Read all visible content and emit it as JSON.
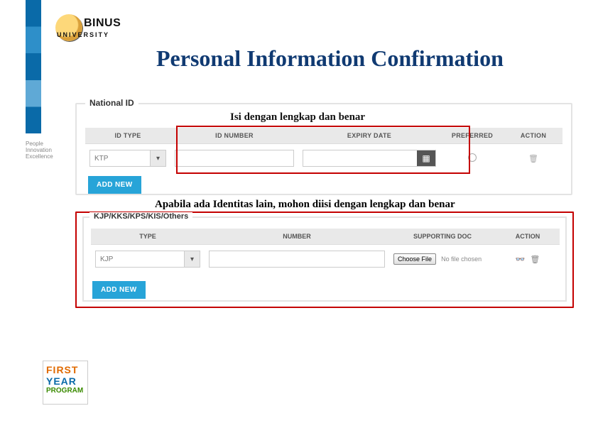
{
  "logo": {
    "brand": "BINUS",
    "sub": "UNIVERSITY"
  },
  "title": "Personal Information Confirmation",
  "side_tag": "People Innovation Excellence",
  "section1": {
    "legend": "National ID",
    "note": "Isi dengan lengkap dan benar",
    "headers": {
      "type": "ID TYPE",
      "number": "ID NUMBER",
      "expiry": "EXPIRY DATE",
      "preferred": "PREFERRED",
      "action": "ACTION"
    },
    "row": {
      "type_value": "KTP",
      "number_value": "",
      "expiry_value": ""
    },
    "add_label": "ADD NEW"
  },
  "section2": {
    "legend": "KJP/KKS/KPS/KIS/Others",
    "note": "Apabila ada Identitas lain, mohon diisi dengan lengkap dan benar",
    "headers": {
      "type": "TYPE",
      "number": "NUMBER",
      "doc": "SUPPORTING DOC",
      "action": "ACTION"
    },
    "row": {
      "type_value": "KJP",
      "number_value": "",
      "file_btn": "Choose File",
      "file_status": "No file chosen"
    },
    "add_label": "ADD NEW"
  },
  "fyp": {
    "r1": "FIRST",
    "r2": "YEAR",
    "r3": "PROGRAM"
  }
}
